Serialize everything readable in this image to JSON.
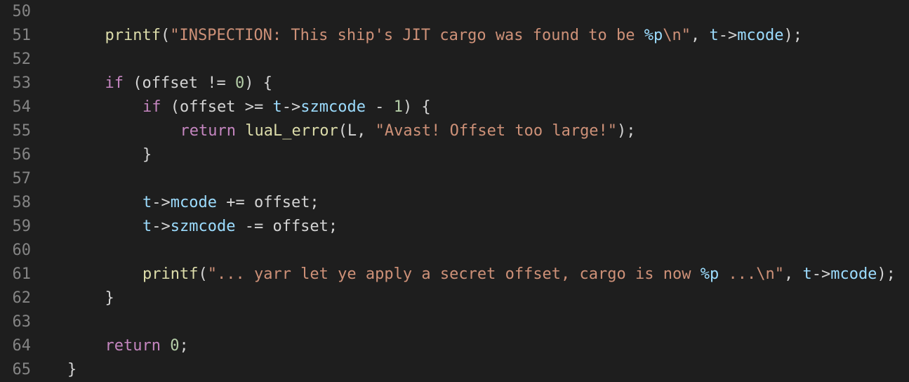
{
  "editor": {
    "theme_colors": {
      "background": "#1e1e1e",
      "line_number": "#858585",
      "keyword": "#c586c0",
      "function": "#dcdcaa",
      "string": "#ce9178",
      "variable": "#9cdcfe",
      "number": "#b5cea8",
      "plain": "#d4d4d4"
    },
    "lines": [
      {
        "number": "50",
        "indent": 0,
        "tokens": []
      },
      {
        "number": "51",
        "indent": 1,
        "tokens": [
          {
            "t": "fn",
            "v": "printf"
          },
          {
            "t": "plain",
            "v": "("
          },
          {
            "t": "str",
            "v": "\"INSPECTION: This ship's JIT cargo was found to be "
          },
          {
            "t": "fmt",
            "v": "%p"
          },
          {
            "t": "str",
            "v": "\\n\""
          },
          {
            "t": "plain",
            "v": ", "
          },
          {
            "t": "var",
            "v": "t"
          },
          {
            "t": "op",
            "v": "->"
          },
          {
            "t": "var",
            "v": "mcode"
          },
          {
            "t": "plain",
            "v": ");"
          }
        ]
      },
      {
        "number": "52",
        "indent": 0,
        "tokens": []
      },
      {
        "number": "53",
        "indent": 1,
        "tokens": [
          {
            "t": "kw",
            "v": "if"
          },
          {
            "t": "plain",
            "v": " (offset "
          },
          {
            "t": "op",
            "v": "!="
          },
          {
            "t": "plain",
            "v": " "
          },
          {
            "t": "num",
            "v": "0"
          },
          {
            "t": "plain",
            "v": ") {"
          }
        ]
      },
      {
        "number": "54",
        "indent": 2,
        "tokens": [
          {
            "t": "kw",
            "v": "if"
          },
          {
            "t": "plain",
            "v": " (offset "
          },
          {
            "t": "op",
            "v": ">="
          },
          {
            "t": "plain",
            "v": " "
          },
          {
            "t": "var",
            "v": "t"
          },
          {
            "t": "op",
            "v": "->"
          },
          {
            "t": "var",
            "v": "szmcode"
          },
          {
            "t": "plain",
            "v": " - "
          },
          {
            "t": "num",
            "v": "1"
          },
          {
            "t": "plain",
            "v": ") {"
          }
        ]
      },
      {
        "number": "55",
        "indent": 3,
        "tokens": [
          {
            "t": "kw",
            "v": "return"
          },
          {
            "t": "plain",
            "v": " "
          },
          {
            "t": "fn",
            "v": "luaL_error"
          },
          {
            "t": "plain",
            "v": "(L, "
          },
          {
            "t": "str",
            "v": "\"Avast! Offset too large!\""
          },
          {
            "t": "plain",
            "v": ");"
          }
        ]
      },
      {
        "number": "56",
        "indent": 2,
        "tokens": [
          {
            "t": "plain",
            "v": "}"
          }
        ]
      },
      {
        "number": "57",
        "indent": 0,
        "tokens": []
      },
      {
        "number": "58",
        "indent": 2,
        "tokens": [
          {
            "t": "var",
            "v": "t"
          },
          {
            "t": "op",
            "v": "->"
          },
          {
            "t": "var",
            "v": "mcode"
          },
          {
            "t": "plain",
            "v": " += offset;"
          }
        ]
      },
      {
        "number": "59",
        "indent": 2,
        "tokens": [
          {
            "t": "var",
            "v": "t"
          },
          {
            "t": "op",
            "v": "->"
          },
          {
            "t": "var",
            "v": "szmcode"
          },
          {
            "t": "plain",
            "v": " -= offset;"
          }
        ]
      },
      {
        "number": "60",
        "indent": 0,
        "tokens": []
      },
      {
        "number": "61",
        "indent": 2,
        "tokens": [
          {
            "t": "fn",
            "v": "printf"
          },
          {
            "t": "plain",
            "v": "("
          },
          {
            "t": "str",
            "v": "\"... yarr let ye apply a secret offset, cargo is now "
          },
          {
            "t": "fmt",
            "v": "%p"
          },
          {
            "t": "str",
            "v": " ...\\n\""
          },
          {
            "t": "plain",
            "v": ", "
          },
          {
            "t": "var",
            "v": "t"
          },
          {
            "t": "op",
            "v": "->"
          },
          {
            "t": "var",
            "v": "mcode"
          },
          {
            "t": "plain",
            "v": ");"
          }
        ]
      },
      {
        "number": "62",
        "indent": 1,
        "tokens": [
          {
            "t": "plain",
            "v": "}"
          }
        ]
      },
      {
        "number": "63",
        "indent": 0,
        "tokens": []
      },
      {
        "number": "64",
        "indent": 1,
        "tokens": [
          {
            "t": "kw",
            "v": "return"
          },
          {
            "t": "plain",
            "v": " "
          },
          {
            "t": "num",
            "v": "0"
          },
          {
            "t": "plain",
            "v": ";"
          }
        ]
      },
      {
        "number": "65",
        "indent": 0,
        "tokens": [
          {
            "t": "plain",
            "v": "}"
          }
        ]
      }
    ]
  }
}
